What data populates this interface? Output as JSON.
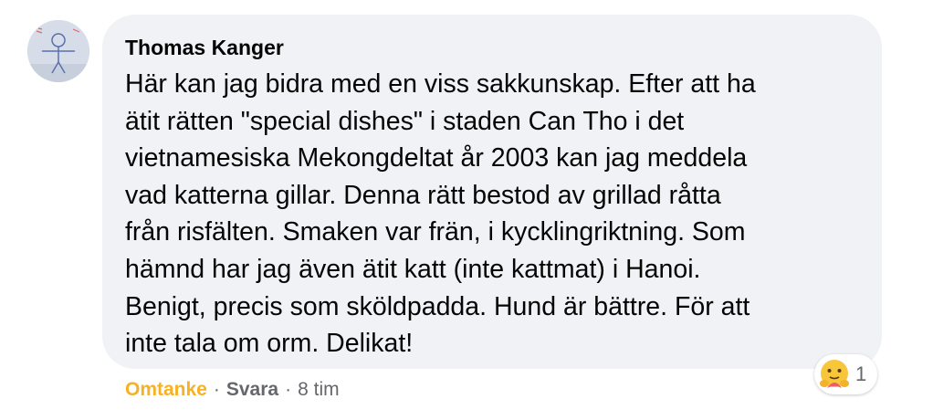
{
  "comment": {
    "author": "Thomas Kanger",
    "text": "Här kan jag bidra med en viss sakkunskap. Efter att ha\nätit rätten \"special dishes\" i staden Can Tho i det\nvietnamesiska Mekongdeltat år 2003 kan jag meddela\nvad katterna gillar. Denna rätt bestod av grillad råtta\nfrån risfälten. Smaken var frän, i kycklingriktning. Som\nhämnd har jag även ätit katt (inte kattmat) i Hanoi.\nBenigt, precis som sköldpadda. Hund är bättre. För att\ninte tala om orm. Delikat!",
    "reaction": {
      "icon": "care-emoji-icon",
      "count": "1"
    },
    "actions": {
      "care_label": "Omtanke",
      "separator": "·",
      "reply_label": "Svara",
      "time": "8 tim"
    }
  },
  "colors": {
    "bubble": "#f0f2f5",
    "text": "#050505",
    "secondary": "#65676b",
    "care": "#f7b125"
  }
}
